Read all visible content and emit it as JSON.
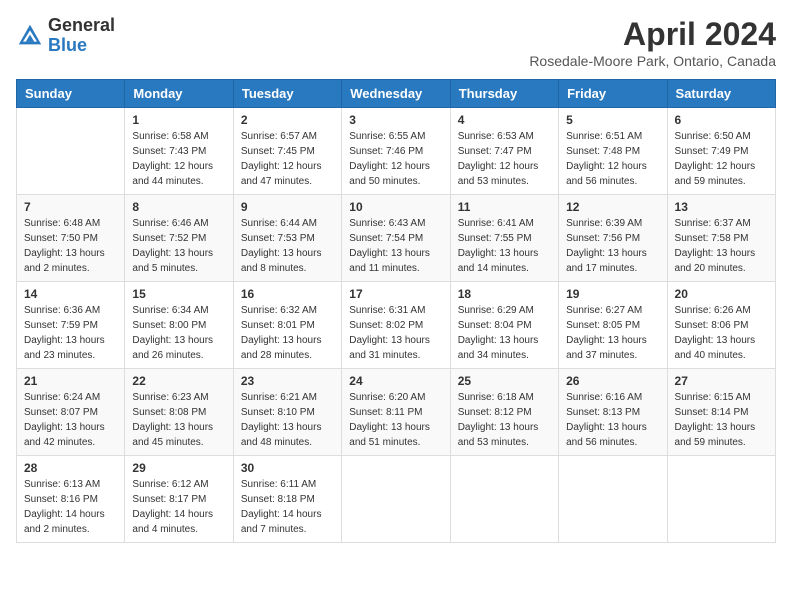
{
  "header": {
    "logo_general": "General",
    "logo_blue": "Blue",
    "month_title": "April 2024",
    "location": "Rosedale-Moore Park, Ontario, Canada"
  },
  "calendar": {
    "days_of_week": [
      "Sunday",
      "Monday",
      "Tuesday",
      "Wednesday",
      "Thursday",
      "Friday",
      "Saturday"
    ],
    "weeks": [
      [
        {
          "day": "",
          "info": ""
        },
        {
          "day": "1",
          "info": "Sunrise: 6:58 AM\nSunset: 7:43 PM\nDaylight: 12 hours\nand 44 minutes."
        },
        {
          "day": "2",
          "info": "Sunrise: 6:57 AM\nSunset: 7:45 PM\nDaylight: 12 hours\nand 47 minutes."
        },
        {
          "day": "3",
          "info": "Sunrise: 6:55 AM\nSunset: 7:46 PM\nDaylight: 12 hours\nand 50 minutes."
        },
        {
          "day": "4",
          "info": "Sunrise: 6:53 AM\nSunset: 7:47 PM\nDaylight: 12 hours\nand 53 minutes."
        },
        {
          "day": "5",
          "info": "Sunrise: 6:51 AM\nSunset: 7:48 PM\nDaylight: 12 hours\nand 56 minutes."
        },
        {
          "day": "6",
          "info": "Sunrise: 6:50 AM\nSunset: 7:49 PM\nDaylight: 12 hours\nand 59 minutes."
        }
      ],
      [
        {
          "day": "7",
          "info": "Sunrise: 6:48 AM\nSunset: 7:50 PM\nDaylight: 13 hours\nand 2 minutes."
        },
        {
          "day": "8",
          "info": "Sunrise: 6:46 AM\nSunset: 7:52 PM\nDaylight: 13 hours\nand 5 minutes."
        },
        {
          "day": "9",
          "info": "Sunrise: 6:44 AM\nSunset: 7:53 PM\nDaylight: 13 hours\nand 8 minutes."
        },
        {
          "day": "10",
          "info": "Sunrise: 6:43 AM\nSunset: 7:54 PM\nDaylight: 13 hours\nand 11 minutes."
        },
        {
          "day": "11",
          "info": "Sunrise: 6:41 AM\nSunset: 7:55 PM\nDaylight: 13 hours\nand 14 minutes."
        },
        {
          "day": "12",
          "info": "Sunrise: 6:39 AM\nSunset: 7:56 PM\nDaylight: 13 hours\nand 17 minutes."
        },
        {
          "day": "13",
          "info": "Sunrise: 6:37 AM\nSunset: 7:58 PM\nDaylight: 13 hours\nand 20 minutes."
        }
      ],
      [
        {
          "day": "14",
          "info": "Sunrise: 6:36 AM\nSunset: 7:59 PM\nDaylight: 13 hours\nand 23 minutes."
        },
        {
          "day": "15",
          "info": "Sunrise: 6:34 AM\nSunset: 8:00 PM\nDaylight: 13 hours\nand 26 minutes."
        },
        {
          "day": "16",
          "info": "Sunrise: 6:32 AM\nSunset: 8:01 PM\nDaylight: 13 hours\nand 28 minutes."
        },
        {
          "day": "17",
          "info": "Sunrise: 6:31 AM\nSunset: 8:02 PM\nDaylight: 13 hours\nand 31 minutes."
        },
        {
          "day": "18",
          "info": "Sunrise: 6:29 AM\nSunset: 8:04 PM\nDaylight: 13 hours\nand 34 minutes."
        },
        {
          "day": "19",
          "info": "Sunrise: 6:27 AM\nSunset: 8:05 PM\nDaylight: 13 hours\nand 37 minutes."
        },
        {
          "day": "20",
          "info": "Sunrise: 6:26 AM\nSunset: 8:06 PM\nDaylight: 13 hours\nand 40 minutes."
        }
      ],
      [
        {
          "day": "21",
          "info": "Sunrise: 6:24 AM\nSunset: 8:07 PM\nDaylight: 13 hours\nand 42 minutes."
        },
        {
          "day": "22",
          "info": "Sunrise: 6:23 AM\nSunset: 8:08 PM\nDaylight: 13 hours\nand 45 minutes."
        },
        {
          "day": "23",
          "info": "Sunrise: 6:21 AM\nSunset: 8:10 PM\nDaylight: 13 hours\nand 48 minutes."
        },
        {
          "day": "24",
          "info": "Sunrise: 6:20 AM\nSunset: 8:11 PM\nDaylight: 13 hours\nand 51 minutes."
        },
        {
          "day": "25",
          "info": "Sunrise: 6:18 AM\nSunset: 8:12 PM\nDaylight: 13 hours\nand 53 minutes."
        },
        {
          "day": "26",
          "info": "Sunrise: 6:16 AM\nSunset: 8:13 PM\nDaylight: 13 hours\nand 56 minutes."
        },
        {
          "day": "27",
          "info": "Sunrise: 6:15 AM\nSunset: 8:14 PM\nDaylight: 13 hours\nand 59 minutes."
        }
      ],
      [
        {
          "day": "28",
          "info": "Sunrise: 6:13 AM\nSunset: 8:16 PM\nDaylight: 14 hours\nand 2 minutes."
        },
        {
          "day": "29",
          "info": "Sunrise: 6:12 AM\nSunset: 8:17 PM\nDaylight: 14 hours\nand 4 minutes."
        },
        {
          "day": "30",
          "info": "Sunrise: 6:11 AM\nSunset: 8:18 PM\nDaylight: 14 hours\nand 7 minutes."
        },
        {
          "day": "",
          "info": ""
        },
        {
          "day": "",
          "info": ""
        },
        {
          "day": "",
          "info": ""
        },
        {
          "day": "",
          "info": ""
        }
      ]
    ]
  }
}
